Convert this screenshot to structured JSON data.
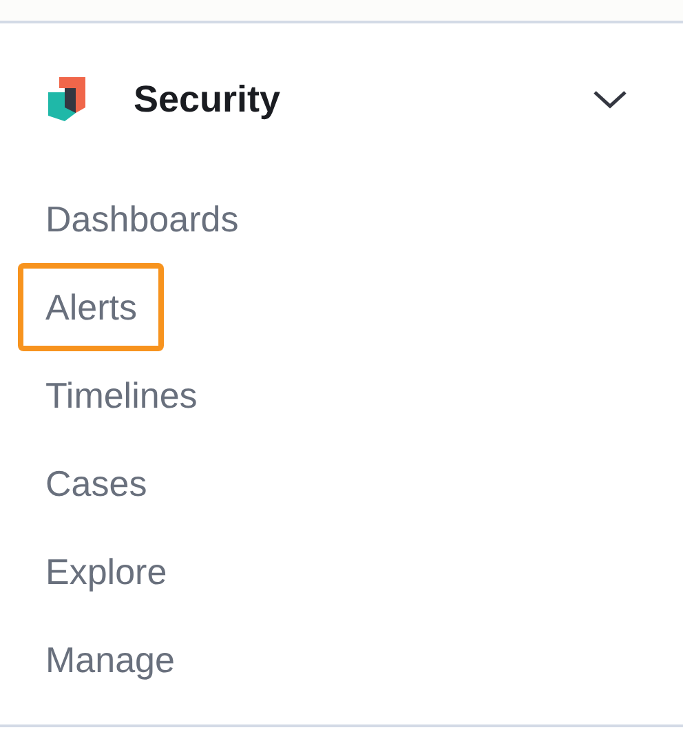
{
  "header": {
    "title": "Security",
    "expanded": true
  },
  "nav_items": [
    {
      "label": "Dashboards",
      "highlighted": false
    },
    {
      "label": "Alerts",
      "highlighted": true
    },
    {
      "label": "Timelines",
      "highlighted": false
    },
    {
      "label": "Cases",
      "highlighted": false
    },
    {
      "label": "Explore",
      "highlighted": false
    },
    {
      "label": "Manage",
      "highlighted": false
    }
  ]
}
